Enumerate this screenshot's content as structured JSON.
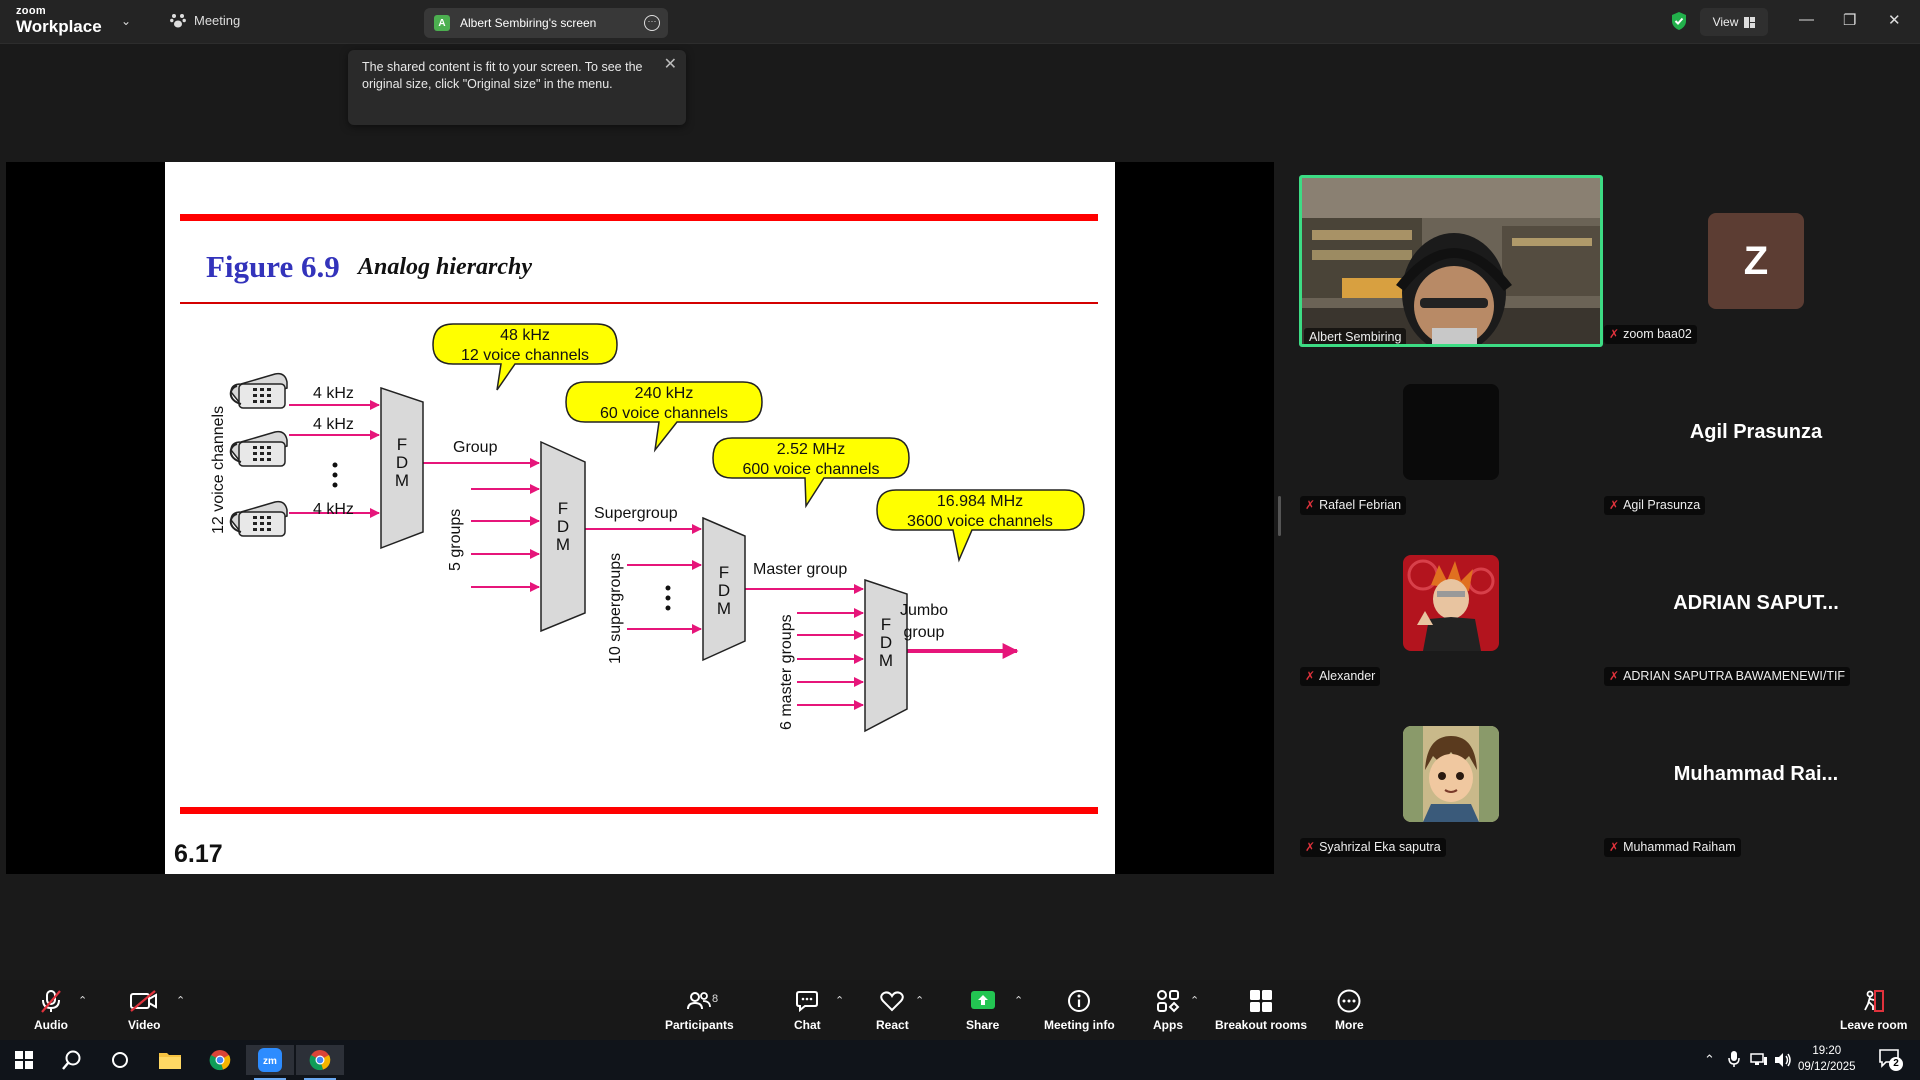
{
  "app": {
    "logo_small": "zoom",
    "logo_big": "Workplace",
    "meeting_label": "Meeting",
    "screen_tab_badge": "A",
    "screen_tab_label": "Albert Sembiring's screen",
    "view_label": "View"
  },
  "toast": {
    "message": "The shared content is fit to your screen. To see the original size, click \"Original size\" in the menu."
  },
  "slide": {
    "figure_label": "Figure 6.9",
    "figure_caption": "Analog hierarchy",
    "page_number": "6.17",
    "diagram": {
      "voice_channels_label": "12 voice channels",
      "khz_labels": [
        "4 kHz",
        "4 kHz",
        "4 kHz"
      ],
      "mux_letters": [
        "F",
        "D",
        "M"
      ],
      "group_label": "Group",
      "groups_label": "5 groups",
      "supergroup_label": "Supergroup",
      "supergroups_label": "10 supergroups",
      "master_group_label": "Master group",
      "master_groups_label": "6 master groups",
      "jumbo_label_1": "Jumbo",
      "jumbo_label_2": "group",
      "bubbles": [
        {
          "line1": "48 kHz",
          "line2": "12 voice channels"
        },
        {
          "line1": "240 kHz",
          "line2": "60 voice channels"
        },
        {
          "line1": "2.52 MHz",
          "line2": "600 voice channels"
        },
        {
          "line1": "16.984 MHz",
          "line2": "3600 voice channels"
        }
      ]
    }
  },
  "participants": [
    {
      "name": "Albert Sembiring",
      "muted": false,
      "type": "video"
    },
    {
      "name": "zoom baa02",
      "muted": true,
      "type": "initial",
      "initial": "Z",
      "color": "#5c3d33"
    },
    {
      "name": "Rafael Febrian",
      "muted": true,
      "type": "black"
    },
    {
      "name": "Agil Prasunza",
      "muted": true,
      "type": "name",
      "display": "Agil Prasunza"
    },
    {
      "name": "Alexander",
      "muted": true,
      "type": "avatar-red"
    },
    {
      "name": "ADRIAN SAPUTRA BAWAMENEWI/TIF",
      "muted": true,
      "type": "name",
      "display": "ADRIAN  SAPUT..."
    },
    {
      "name": "Syahrizal Eka saputra",
      "muted": true,
      "type": "avatar-anime"
    },
    {
      "name": "Muhammad Raiham",
      "muted": true,
      "type": "name",
      "display": "Muhammad  Rai..."
    }
  ],
  "toolbar": {
    "audio": "Audio",
    "video": "Video",
    "participants": "Participants",
    "participants_count": "8",
    "chat": "Chat",
    "react": "React",
    "share": "Share",
    "meeting_info": "Meeting info",
    "apps": "Apps",
    "breakout_rooms": "Breakout rooms",
    "more": "More",
    "leave_room": "Leave room"
  },
  "taskbar": {
    "time": "19:20",
    "date": "09/12/2025",
    "notification_count": "2"
  },
  "colors": {
    "accent_green": "#3ddc84",
    "muted_red": "#e0323c",
    "slide_red": "#ff0000",
    "figure_blue": "#3333bb",
    "bubble_yellow": "#ffff00",
    "arrow_magenta": "#e6157a"
  }
}
